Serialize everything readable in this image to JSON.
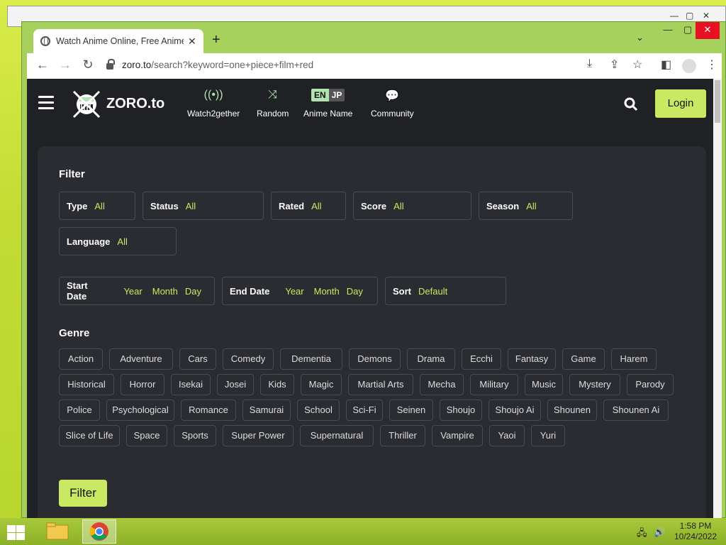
{
  "browser": {
    "tab_title": "Watch Anime Online, Free Anime",
    "url_host": "zoro.to",
    "url_path": "/search?keyword=one+piece+film+red"
  },
  "header": {
    "logo_text": "ZORO.to",
    "nav": [
      {
        "label": "Watch2gether",
        "icon": "broadcast-icon"
      },
      {
        "label": "Random",
        "icon": "shuffle-icon"
      },
      {
        "label": "Anime Name",
        "icon": "language-toggle"
      },
      {
        "label": "Community",
        "icon": "chat-icon"
      }
    ],
    "lang_en": "EN",
    "lang_jp": "JP",
    "login": "Login"
  },
  "filter": {
    "title": "Filter",
    "type": {
      "label": "Type",
      "value": "All"
    },
    "status": {
      "label": "Status",
      "value": "All"
    },
    "rated": {
      "label": "Rated",
      "value": "All"
    },
    "score": {
      "label": "Score",
      "value": "All"
    },
    "season": {
      "label": "Season",
      "value": "All"
    },
    "language": {
      "label": "Language",
      "value": "All"
    },
    "start_date": {
      "label": "Start Date",
      "year": "Year",
      "month": "Month",
      "day": "Day"
    },
    "end_date": {
      "label": "End Date",
      "year": "Year",
      "month": "Month",
      "day": "Day"
    },
    "sort": {
      "label": "Sort",
      "value": "Default"
    },
    "button": "Filter"
  },
  "genre": {
    "title": "Genre",
    "items": [
      "Action",
      "Adventure",
      "Cars",
      "Comedy",
      "Dementia",
      "Demons",
      "Drama",
      "Ecchi",
      "Fantasy",
      "Game",
      "Harem",
      "Historical",
      "Horror",
      "Isekai",
      "Josei",
      "Kids",
      "Magic",
      "Martial Arts",
      "Mecha",
      "Military",
      "Music",
      "Mystery",
      "Parody",
      "Police",
      "Psychological",
      "Romance",
      "Samurai",
      "School",
      "Sci-Fi",
      "Seinen",
      "Shoujo",
      "Shoujo Ai",
      "Shounen",
      "Shounen Ai",
      "Slice of Life",
      "Space",
      "Sports",
      "Super Power",
      "Supernatural",
      "Thriller",
      "Vampire",
      "Yaoi",
      "Yuri"
    ]
  },
  "taskbar": {
    "time": "1:58 PM",
    "date": "10/24/2022"
  },
  "colors": {
    "accent": "#cae962",
    "background": "#202125",
    "panel": "#2a2c31"
  }
}
